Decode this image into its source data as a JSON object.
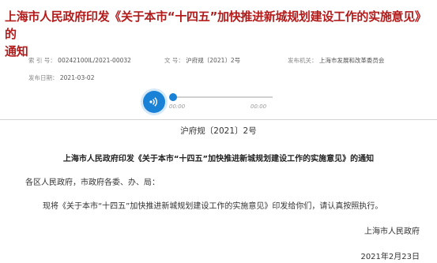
{
  "header": {
    "title_line1": "上海市人民政府印发《关于本市“十四五”加快推进新城规划建设工作的实施意见》的",
    "title_line2": "通知"
  },
  "meta": {
    "index_label": "索 引 号：",
    "index_value": "00242100IL/2021-00032",
    "docnum_label": "文 号：",
    "docnum_value": "沪府规〔2021〕2号",
    "issuer_label": "发布机关：",
    "issuer_value": "上海市发展和改革委员会",
    "date_label": "发布日期：",
    "date_value": "2021-03-02"
  },
  "audio": {
    "current_time": "00:00",
    "duration": "00:00",
    "progress": 0
  },
  "document": {
    "doc_number": "沪府规〔2021〕2号",
    "title": "上海市人民政府印发《关于本市“十四五”加快推进新城规划建设工作的实施意见》的通知",
    "salutation": "各区人民政府，市政府各委、办、局：",
    "body": "现将《关于本市“十四五”加快推进新城规划建设工作的实施意见》印发给你们，请认真按照执行。",
    "signer": "上海市人民政府",
    "date": "2021年2月23日"
  },
  "colors": {
    "title": "#b31b1b",
    "accent": "#1a82d6"
  }
}
